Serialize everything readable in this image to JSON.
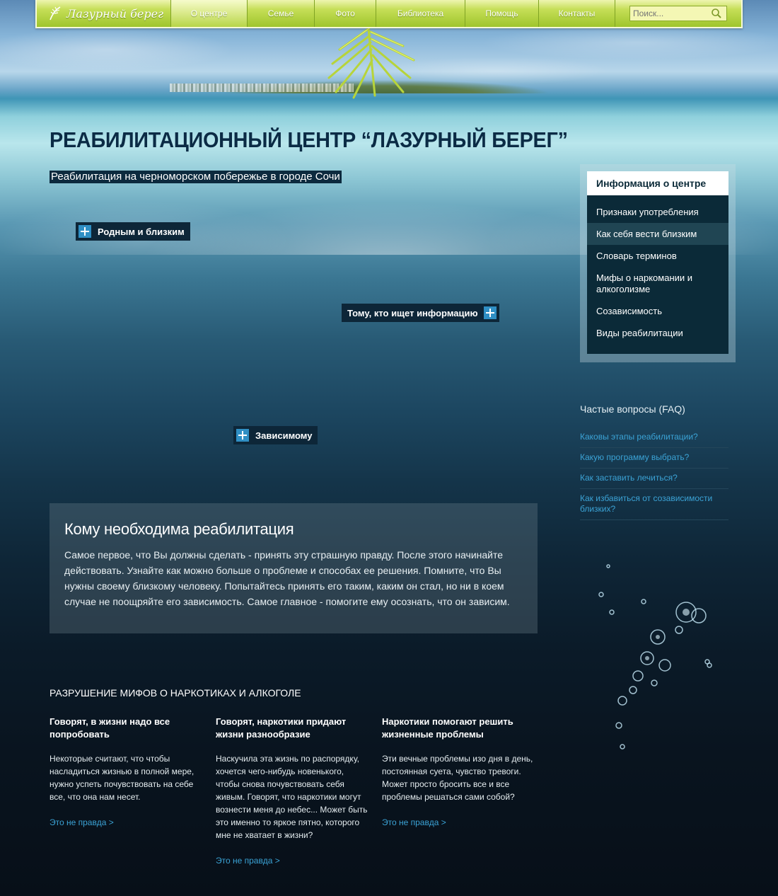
{
  "nav": {
    "logo_text": "Лазурный берег",
    "items": [
      {
        "label": "О центре",
        "active": true
      },
      {
        "label": "Семье",
        "active": false
      },
      {
        "label": "Фото",
        "active": false
      },
      {
        "label": "Библиотека",
        "active": false
      },
      {
        "label": "Помощь",
        "active": false
      },
      {
        "label": "Контакты",
        "active": false
      }
    ],
    "search_placeholder": "Поиск..."
  },
  "header": {
    "title": "РЕАБИЛИТАЦИОННЫЙ ЦЕНТР “ЛАЗУРНЫЙ БЕРЕГ”",
    "subtitle": "Реабилитация на черноморском побережье в городе Сочи"
  },
  "hotspots": {
    "relatives": "Родным и близким",
    "info_seeker": "Тому, кто ищет информацию",
    "addicted": "Зависимому"
  },
  "sidebar": {
    "title": "Информация о центре",
    "items": [
      "Признаки употребления",
      "Как себя вести близким",
      "Словарь терминов",
      "Мифы о наркомании и алкоголизме",
      "Созависимость",
      "Виды реабилитации"
    ]
  },
  "faq": {
    "title": "Частые вопросы (FAQ)",
    "items": [
      "Каковы этапы реабилитации?",
      "Какую программу выбрать?",
      "Как заставить лечиться?",
      "Как избавиться от созависимости близких?"
    ]
  },
  "who": {
    "title": "Кому необходима реабилитация",
    "text": "Самое первое, что Вы должны сделать - принять эту страшную правду. После этого начинайте действовать. Узнайте как можно больше о проблеме и способах ее решения. Помните, что Вы нужны своему близкому человеку. Попытайтесь принять его таким, каким он стал, но ни в коем случае не поощряйте его зависимость. Самое главное - помогите ему осознать, что он зависим."
  },
  "myths": {
    "title": "РАЗРУШЕНИЕ МИФОВ О НАРКОТИКАХ И АЛКОГОЛЕ",
    "items": [
      {
        "heading": "Говорят, в жизни надо все попробовать",
        "text": "Некоторые считают, что чтобы насладиться жизнью в полной мере, нужно успеть почувствовать на себе все, что она нам несет.",
        "link": "Это не правда >"
      },
      {
        "heading": "Говорят, наркотики придают жизни разнообразие",
        "text": "Наскучила эта жизнь по распорядку, хочется чего-нибудь новенького, чтобы снова почувствовать себя живым. Говорят, что наркотики могут вознести меня до небес... Может быть это именно то яркое пятно, которого мне не хватает в жизни?",
        "link": "Это не правда >"
      },
      {
        "heading": "Наркотики помогают решить жизненные проблемы",
        "text": "Эти вечные проблемы изо дня в день, постоянная суета, чувство тревоги. Может просто бросить все и все проблемы решаться сами собой?",
        "link": "Это не правда >"
      }
    ]
  }
}
